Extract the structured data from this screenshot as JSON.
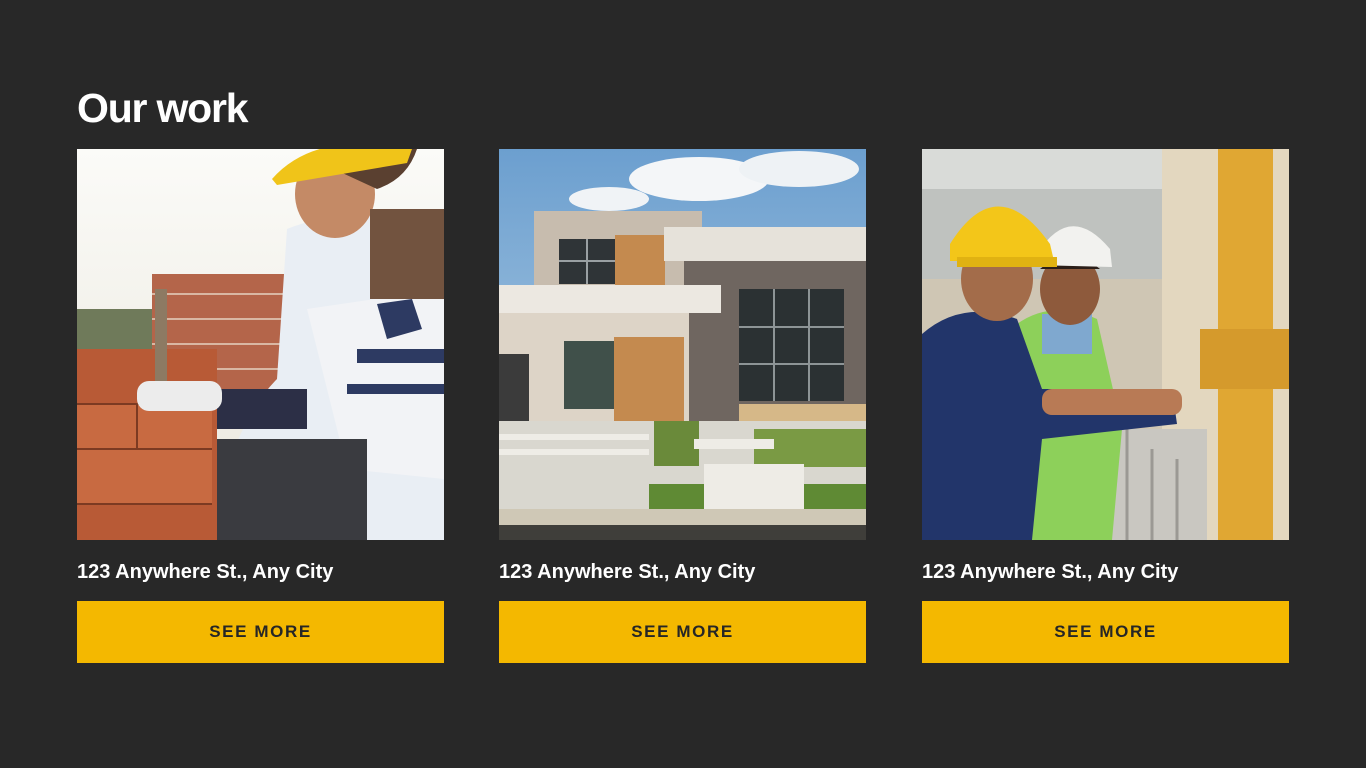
{
  "section": {
    "title": "Our work"
  },
  "cards": [
    {
      "address": "123 Anywhere St., Any City",
      "button_label": "SEE MORE",
      "photo": "bricklayer-worker-photo"
    },
    {
      "address": "123 Anywhere St., Any City",
      "button_label": "SEE MORE",
      "photo": "modern-house-photo"
    },
    {
      "address": "123 Anywhere St., Any City",
      "button_label": "SEE MORE",
      "photo": "construction-workers-photo"
    }
  ],
  "colors": {
    "background": "#282828",
    "accent": "#f4b800",
    "text": "#ffffff",
    "button_text": "#262626"
  }
}
